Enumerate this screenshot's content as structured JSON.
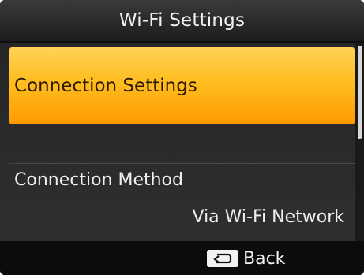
{
  "header": {
    "title": "Wi-Fi Settings"
  },
  "menu": {
    "selected_item": "Connection Settings",
    "connection_method": {
      "label": "Connection Method",
      "value": "Via Wi-Fi Network"
    }
  },
  "footer": {
    "back_icon": "return-arrow-icon",
    "back_label": "Back"
  },
  "colors": {
    "highlight_top": "#ffd257",
    "highlight_bottom": "#ff9a00",
    "background": "#232323"
  }
}
